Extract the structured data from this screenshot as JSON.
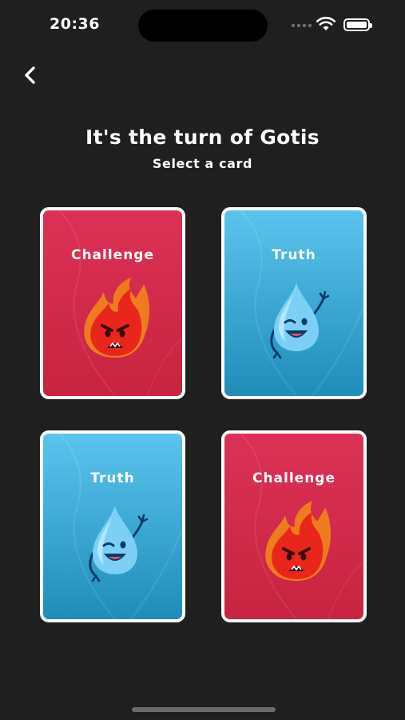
{
  "status_bar": {
    "time": "20:36",
    "icons": [
      "signal-icon",
      "wifi-icon",
      "battery-icon"
    ]
  },
  "nav": {
    "back_icon": "chevron-left-icon"
  },
  "header": {
    "title": "It's the turn of Gotis",
    "subtitle": "Select a card"
  },
  "cards": [
    {
      "label": "Challenge",
      "type": "challenge",
      "color": "#d42b4c",
      "mascot": "angry-flame-icon"
    },
    {
      "label": "Truth",
      "type": "truth",
      "color": "#3aa9d8",
      "mascot": "winking-water-drop-icon"
    },
    {
      "label": "Truth",
      "type": "truth",
      "color": "#3aa9d8",
      "mascot": "winking-water-drop-icon"
    },
    {
      "label": "Challenge",
      "type": "challenge",
      "color": "#d42b4c",
      "mascot": "angry-flame-icon"
    }
  ],
  "theme": {
    "background": "#1f1f1f",
    "challenge_color": "#d42b4c",
    "truth_color": "#3aa9d8"
  }
}
